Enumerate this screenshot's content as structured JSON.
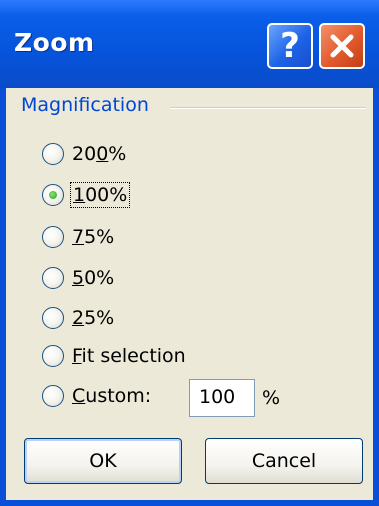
{
  "window": {
    "title": "Zoom"
  },
  "titlebar": {
    "help_icon": "help-icon",
    "close_icon": "close-icon",
    "help_glyph": "?"
  },
  "group": {
    "label": "Magnification"
  },
  "options": [
    {
      "pre": "20",
      "ul": "0",
      "post": "%",
      "checked": false
    },
    {
      "pre": "",
      "ul": "1",
      "post": "00%",
      "checked": true
    },
    {
      "pre": "",
      "ul": "7",
      "post": "5%",
      "checked": false
    },
    {
      "pre": "",
      "ul": "5",
      "post": "0%",
      "checked": false
    },
    {
      "pre": "",
      "ul": "2",
      "post": "5%",
      "checked": false
    },
    {
      "pre": "",
      "ul": "F",
      "post": "it selection",
      "checked": false
    },
    {
      "pre": "",
      "ul": "C",
      "post": "ustom:",
      "checked": false
    }
  ],
  "custom": {
    "value": "100",
    "unit": "%"
  },
  "buttons": {
    "ok": "OK",
    "cancel": "Cancel"
  }
}
